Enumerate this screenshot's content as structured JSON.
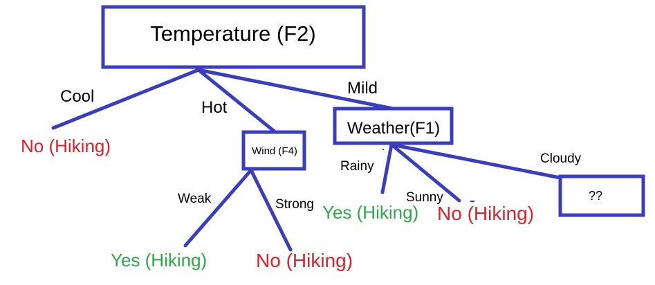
{
  "nodes": {
    "root": "Temperature (F2)",
    "weather": "Weather(F1)",
    "wind": "Wind (F4)",
    "unknown": "??"
  },
  "edges": {
    "cool": "Cool",
    "hot": "Hot",
    "mild": "Mild",
    "rainy": "Rainy",
    "sunny": "Sunny",
    "cloudy": "Cloudy",
    "weak": "Weak",
    "strong": "Strong"
  },
  "leaves": {
    "cool_no": "No (Hiking)",
    "rainy_yes": "Yes (Hiking)",
    "sunny_no": "No (Hiking)",
    "weak_yes": "Yes (Hiking)",
    "strong_no": "No (Hiking)"
  },
  "colors": {
    "line": "#3b3dbf",
    "no": "#e0202a",
    "yes": "#2ea84a",
    "text": "#000000"
  }
}
